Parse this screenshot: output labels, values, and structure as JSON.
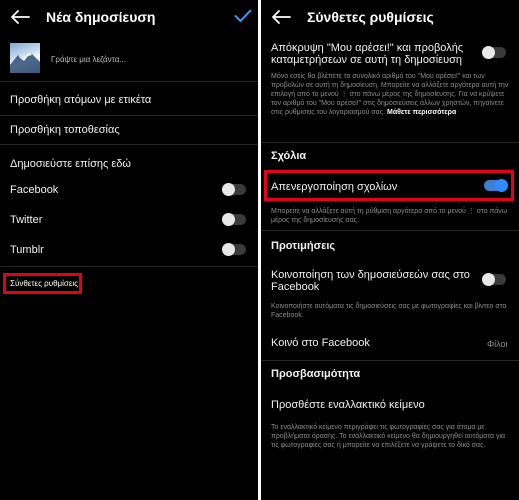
{
  "left": {
    "title": "Νέα δημοσίευση",
    "caption_placeholder": "Γράψτε μια λεζάντα...",
    "tag_people": "Προσθήκη ατόμων με ετικέτα",
    "add_location": "Προσθήκη τοποθεσίας",
    "also_post_heading": "Δημοσιεύστε επίσης εδώ",
    "share_targets": [
      {
        "label": "Facebook",
        "on": false
      },
      {
        "label": "Twitter",
        "on": false
      },
      {
        "label": "Tumblr",
        "on": false
      }
    ],
    "advanced_settings": "Σύνθετες ρυθμίσεις"
  },
  "right": {
    "title": "Σύνθετες ρυθμίσεις",
    "hide_likes_label": "Απόκρυψη \"Μου αρέσει!\" και προβολής καταμετρήσεων σε αυτή τη δημοσίευση",
    "hide_likes_on": false,
    "hide_likes_help": "Μόνο εσείς θα βλέπετε το συνολικό αριθμό του \"Μου αρέσει!\" και των προβολών σε αυτή τη δημοσίευση. Μπορείτε να αλλάξετε αργότερα αυτή την επιλογή από το μενού ⋮ στο πάνω μέρος της δημοσίευσης. Για να κρύψετε τον αριθμό του \"Μου αρέσει!\" στις δημοσιεύσεις άλλων χρηστών, πηγαίνετε στις ρυθμίσεις του λογαριασμού σας.",
    "learn_more": "Μάθετε περισσότερα",
    "comments_heading": "Σχόλια",
    "disable_comments_label": "Απενεργοποίηση σχολίων",
    "disable_comments_on": true,
    "disable_comments_help": "Μπορείτε να αλλάξετε αυτή τη ρύθμιση αργότερα από το μενού ⋮ στο πάνω μέρος της δημοσίευσης σας.",
    "preferences_heading": "Προτιμήσεις",
    "share_fb_label": "Κοινοποίηση των δημοσιεύσεών σας στο Facebook",
    "share_fb_on": false,
    "share_fb_help": "Κοινοποιήστε αυτόματα τις δημοσιεύσεις σας με φωτογραφίες και βίντεο στο Facebook.",
    "audience_label": "Κοινό στο Facebook",
    "audience_value": "Φίλοι",
    "accessibility_heading": "Προσβασιμότητα",
    "alt_text_label": "Προσθέστε εναλλακτικό κείμενο",
    "alt_text_help": "Το εναλλακτικό κείμενο περιγράφει τις φωτογραφίες σας για άτομα με προβλήματα όρασης. Το εναλλακτικό κείμενο θα δημιουργηθεί αυτόματα για τις φωτογραφίες σας ή μπορείτε να επιλέξετε να γράψετε το δικό σας."
  },
  "colors": {
    "accent": "#3897f0",
    "toggle_on": "#2f8cff",
    "highlight": "#e3001b",
    "background": "#000000"
  }
}
